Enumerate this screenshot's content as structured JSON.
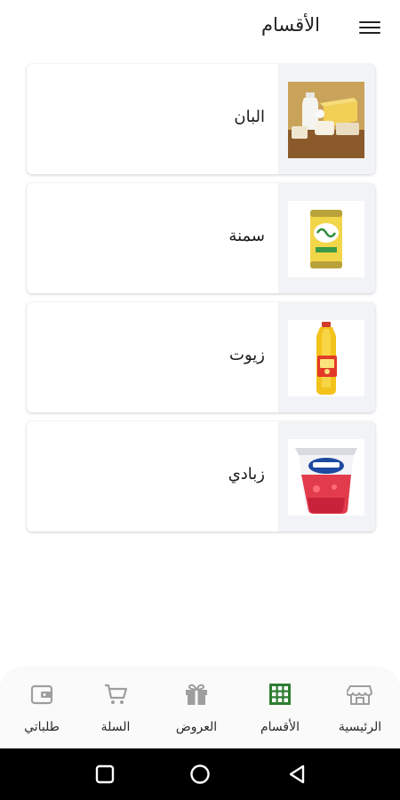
{
  "header": {
    "title": "الأقسام",
    "menu_icon": "hamburger-menu-icon"
  },
  "categories": [
    {
      "label": "البان",
      "image": "dairy-cheese-milk-photo"
    },
    {
      "label": "سمنة",
      "image": "ghee-tin-can-photo"
    },
    {
      "label": "زيوت",
      "image": "cooking-oil-bottle-photo"
    },
    {
      "label": "زبادي",
      "image": "strawberry-yogurt-cup-photo"
    }
  ],
  "bottom_nav": {
    "active_color": "#2e7d32",
    "inactive_color": "#9e9e9e",
    "items": [
      {
        "label": "الرئيسية",
        "icon": "store-icon",
        "active": false
      },
      {
        "label": "الأقسام",
        "icon": "grid-icon",
        "active": true
      },
      {
        "label": "العروض",
        "icon": "gift-icon",
        "active": false
      },
      {
        "label": "السلة",
        "icon": "cart-icon",
        "active": false
      },
      {
        "label": "طلباتي",
        "icon": "wallet-icon",
        "active": false
      }
    ]
  },
  "system_nav": {
    "buttons": [
      "recents-square-icon",
      "home-circle-icon",
      "back-triangle-icon"
    ]
  }
}
